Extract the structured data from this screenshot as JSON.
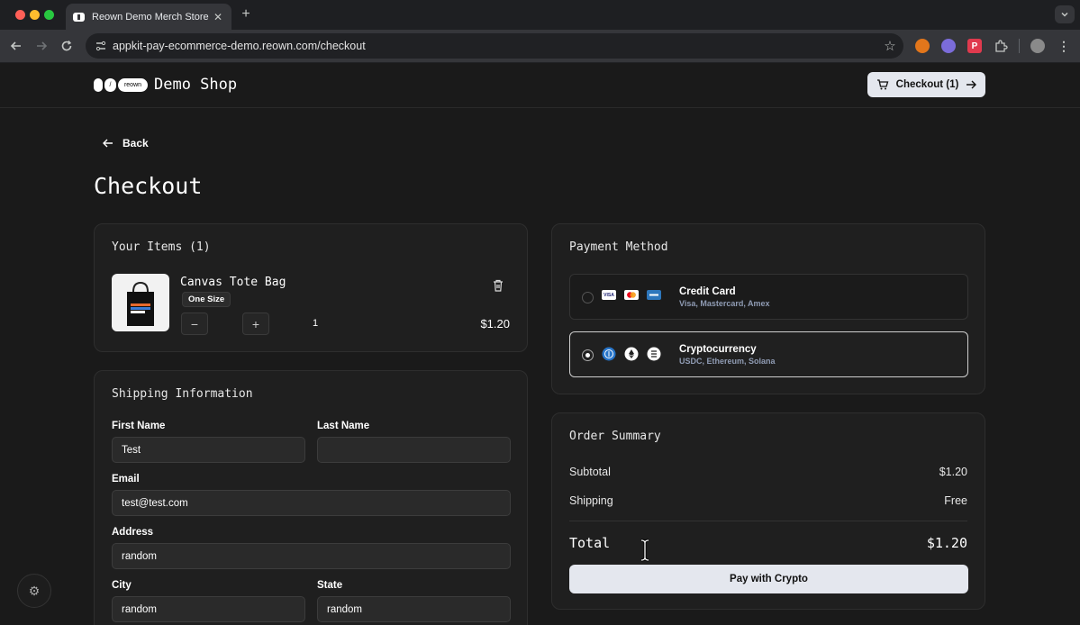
{
  "browser": {
    "tab_title": "Reown Demo Merch Store",
    "url": "appkit-pay-ecommerce-demo.reown.com/checkout",
    "tab_close": "✕",
    "new_tab": "+",
    "tab_menu_icon": "chevron-down-icon"
  },
  "header": {
    "logo_text": "reown",
    "brand": "Demo Shop",
    "checkout_button": "Checkout (1)"
  },
  "nav": {
    "back_label": "Back"
  },
  "page": {
    "title": "Checkout"
  },
  "items": {
    "title": "Your Items (1)",
    "list": [
      {
        "name": "Canvas Tote Bag",
        "size": "One Size",
        "quantity": "1",
        "price": "$1.20"
      }
    ],
    "minus": "−",
    "plus": "+"
  },
  "shipping": {
    "title": "Shipping Information",
    "first_name_label": "First Name",
    "first_name_value": "Test",
    "last_name_label": "Last Name",
    "last_name_value": "",
    "email_label": "Email",
    "email_value": "test@test.com",
    "address_label": "Address",
    "address_value": "random",
    "city_label": "City",
    "city_value": "random",
    "state_label": "State",
    "state_value": "random"
  },
  "payment": {
    "title": "Payment Method",
    "options": [
      {
        "name": "Credit Card",
        "sub": "Visa, Mastercard, Amex",
        "selected": false,
        "icons": [
          "visa-icon",
          "mastercard-icon",
          "amex-icon"
        ]
      },
      {
        "name": "Cryptocurrency",
        "sub": "USDC, Ethereum, Solana",
        "selected": true,
        "icons": [
          "usdc-icon",
          "ethereum-icon",
          "solana-icon"
        ]
      }
    ],
    "visa_text": "VISA"
  },
  "summary": {
    "title": "Order Summary",
    "subtotal_label": "Subtotal",
    "subtotal_value": "$1.20",
    "shipping_label": "Shipping",
    "shipping_value": "Free",
    "total_label": "Total",
    "total_value": "$1.20",
    "pay_button": "Pay with Crypto"
  },
  "colors": {
    "page_bg": "#1a1a1a",
    "card_bg": "#1f1f1f",
    "button_bg": "#e4e7ee",
    "subtext": "#8f9bb3"
  }
}
